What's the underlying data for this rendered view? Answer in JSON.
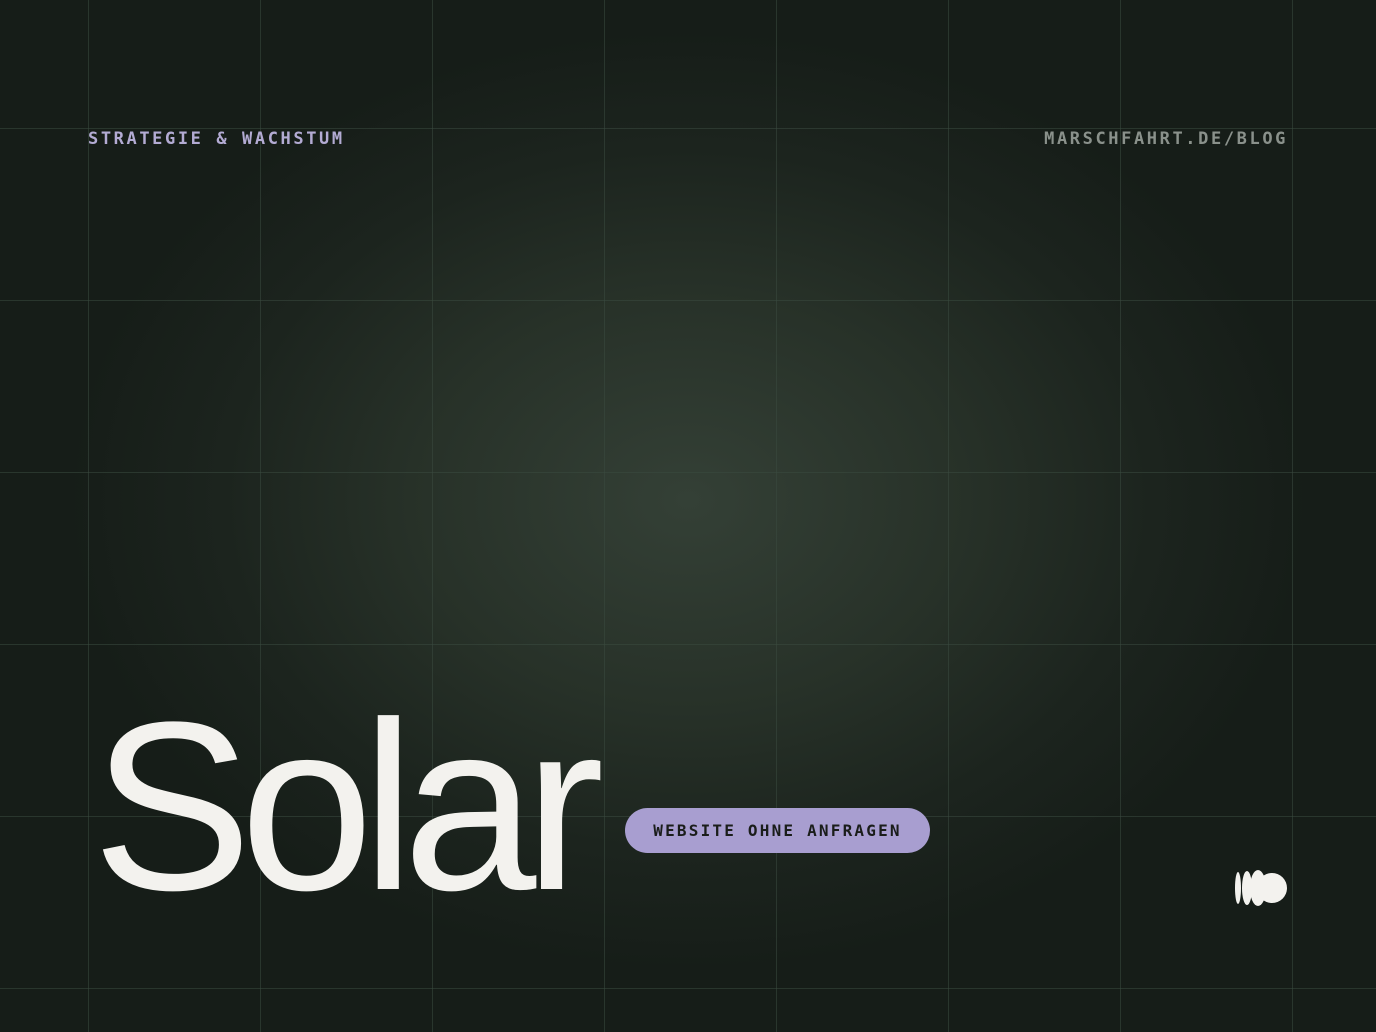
{
  "eyebrow": "STRATEGIE & WACHSTUM",
  "site_url": "MARSCHFAHRT.DE/BLOG",
  "headline": "Solar",
  "tag": "WEBSITE OHNE ANFRAGEN",
  "logo_icon": "marschfahrt-logo-icon",
  "colors": {
    "background": "#1a211c",
    "eyebrow": "#b3abd3",
    "site_url": "#8a918b",
    "headline": "#f3f2ee",
    "tag_background": "#a89ed0",
    "tag_text": "#1a1d1a",
    "logo": "#f3f2ee"
  }
}
